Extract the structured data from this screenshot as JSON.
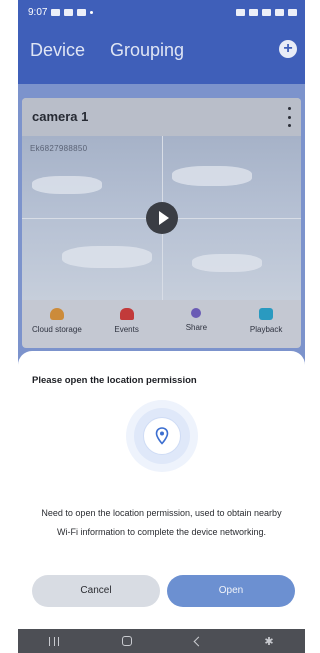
{
  "status_bar": {
    "time": "9:07"
  },
  "header": {
    "tabs": [
      {
        "label": "Device"
      },
      {
        "label": "Grouping"
      }
    ],
    "add_icon": "plus-circle-icon"
  },
  "camera_card": {
    "name": "camera 1",
    "device_id": "Ek6827988850",
    "actions": [
      {
        "label": "Cloud storage",
        "icon": "cloud-icon"
      },
      {
        "label": "Events",
        "icon": "alarm-icon"
      },
      {
        "label": "Share",
        "icon": "share-icon"
      },
      {
        "label": "Playback",
        "icon": "playback-icon"
      }
    ]
  },
  "dialog": {
    "title": "Please open the location permission",
    "icon": "location-pin-icon",
    "message": "Need to open the location permission, used to obtain nearby Wi-Fi information to complete the device networking.",
    "cancel_label": "Cancel",
    "open_label": "Open"
  },
  "colors": {
    "header_bg": "#3f5fb9",
    "open_button": "#6c90d1",
    "cancel_button": "#d8dce3"
  }
}
